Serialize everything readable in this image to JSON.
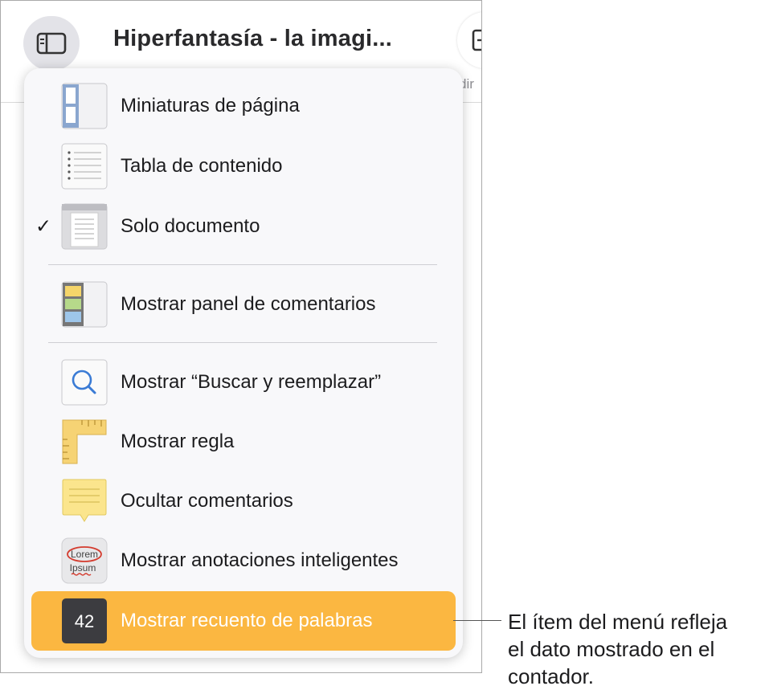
{
  "toolbar": {
    "title": "Hiperfantasía - la imagi...",
    "right_button_label_partial": "dir"
  },
  "menu": {
    "items": [
      {
        "label": "Miniaturas de página",
        "icon": "page-thumbnails-icon",
        "checked": false
      },
      {
        "label": "Tabla de contenido",
        "icon": "table-of-contents-icon",
        "checked": false
      },
      {
        "label": "Solo documento",
        "icon": "document-only-icon",
        "checked": true,
        "check_glyph": "✓"
      },
      {
        "label": "Mostrar panel de comentarios",
        "icon": "comments-pane-icon",
        "checked": false
      },
      {
        "label": "Mostrar “Buscar y reemplazar”",
        "icon": "search-icon",
        "checked": false
      },
      {
        "label": "Mostrar regla",
        "icon": "ruler-icon",
        "checked": false
      },
      {
        "label": "Ocultar comentarios",
        "icon": "comment-note-icon",
        "checked": false
      },
      {
        "label": "Mostrar anotaciones inteligentes",
        "icon": "smart-annotations-icon",
        "checked": false,
        "icon_text_1": "Lorem",
        "icon_text_2": "Ipsum"
      },
      {
        "label": "Mostrar recuento de palabras",
        "icon": "word-count-icon",
        "checked": false,
        "highlighted": true,
        "icon_text": "42"
      }
    ]
  },
  "callout": {
    "line1": "El ítem del menú refleja",
    "line2": "el dato mostrado en el",
    "line3": "contador."
  },
  "colors": {
    "highlight": "#fbb741",
    "menu_bg": "#f8f8fa",
    "button_bg": "#e3e3e8"
  }
}
